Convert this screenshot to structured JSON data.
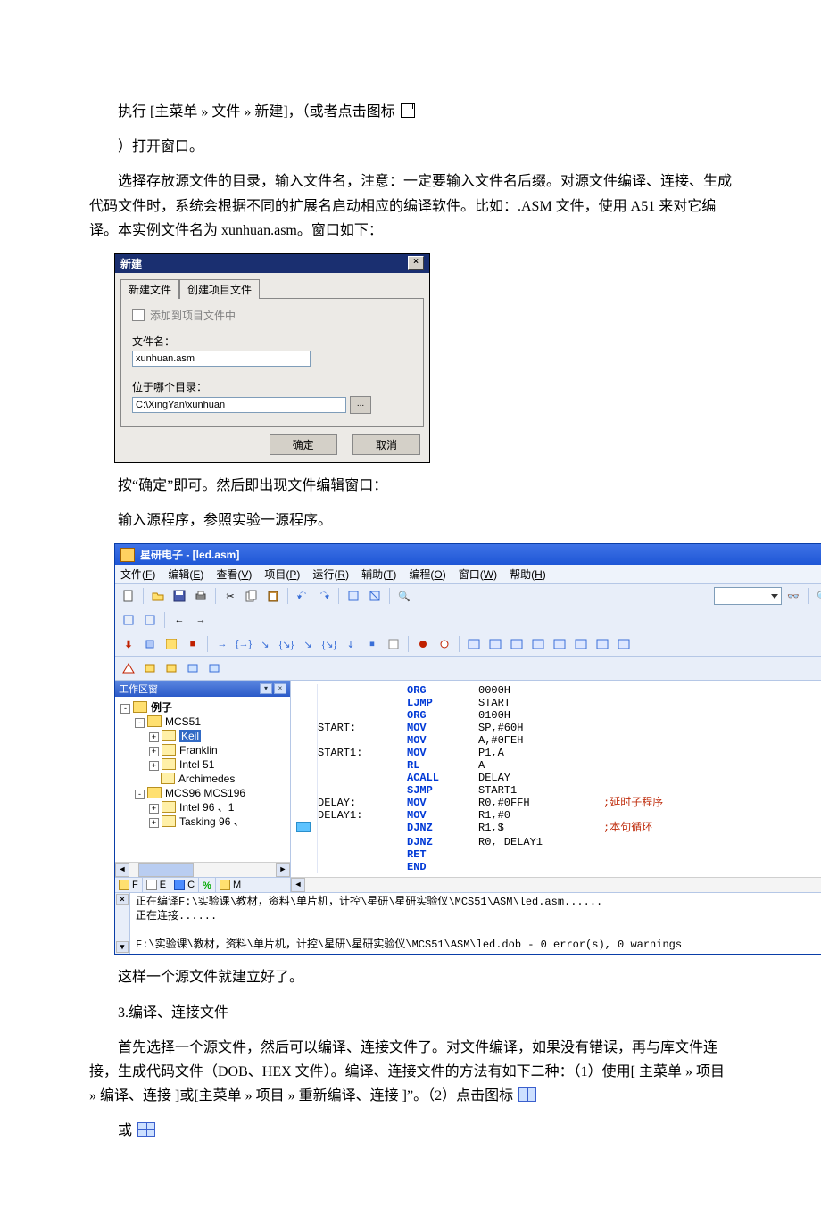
{
  "paragraphs": {
    "p1_a": "执行 [主菜单 » 文件 » 新建]，（或者点击图标",
    "p1_b": "）打开窗口。",
    "p2": "选择存放源文件的目录，输入文件名，注意：一定要输入文件名后缀。对源文件编译、连接、生成代码文件时，系统会根据不同的扩展名启动相应的编译软件。比如：.ASM 文件，使用 A51 来对它编译。本实例文件名为 xunhuan.asm。窗口如下：",
    "p3": "按“确定”即可。然后即出现文件编辑窗口：",
    "p4": "输入源程序，参照实验一源程序。",
    "p5": "这样一个源文件就建立好了。",
    "p6": "3.编译、连接文件",
    "p7_a": "首先选择一个源文件，然后可以编译、连接文件了。对文件编译，如果没有错误，再与库文件连接，生成代码文件（DOB、HEX 文件）。编译、连接文件的方法有如下二种：（1）使用[ 主菜单 » 项目 » 编译、连接 ]或[主菜单 » 项目 » 重新编译、连接 ]”。（2）点击图标",
    "p7_b": "或"
  },
  "dialog": {
    "title": "新建",
    "tab_new": "新建文件",
    "tab_proj": "创建项目文件",
    "chk_label": "添加到项目文件中",
    "filename_label": "文件名：",
    "filename_value": "xunhuan.asm",
    "dir_label": "位于哪个目录：",
    "dir_value": "C:\\XingYan\\xunhuan",
    "browse": "...",
    "ok": "确定",
    "cancel": "取消",
    "close_x": "×"
  },
  "ide": {
    "title": "星研电子 - [led.asm]",
    "menus": [
      {
        "t": "文件",
        "a": "F"
      },
      {
        "t": "编辑",
        "a": "E"
      },
      {
        "t": "查看",
        "a": "V"
      },
      {
        "t": "项目",
        "a": "P"
      },
      {
        "t": "运行",
        "a": "R"
      },
      {
        "t": "辅助",
        "a": "T"
      },
      {
        "t": "编程",
        "a": "O"
      },
      {
        "t": "窗口",
        "a": "W"
      },
      {
        "t": "帮助",
        "a": "H"
      }
    ],
    "workspace_title": "工作区窗",
    "tree_root": "例子",
    "tree": [
      {
        "lvl": 1,
        "open": true,
        "label": "MCS51",
        "pm": "-"
      },
      {
        "lvl": 2,
        "open": false,
        "label": "Keil",
        "pm": "+",
        "sel": true
      },
      {
        "lvl": 2,
        "open": false,
        "label": "Franklin",
        "pm": "+"
      },
      {
        "lvl": 2,
        "open": false,
        "label": "Intel 51",
        "pm": "+"
      },
      {
        "lvl": 2,
        "open": false,
        "label": "Archimedes",
        "pm": ""
      },
      {
        "lvl": 1,
        "open": true,
        "label": "MCS96 MCS196",
        "pm": "-"
      },
      {
        "lvl": 2,
        "open": false,
        "label": "Intel 96 、1",
        "pm": "+"
      },
      {
        "lvl": 2,
        "open": false,
        "label": "Tasking 96 、",
        "pm": "+"
      }
    ],
    "ws_tabs": [
      "F",
      "E",
      "C",
      "%",
      "M"
    ],
    "ws_tab_labels": {
      "F": "F",
      "E": "E",
      "C": "C",
      "pct": "%",
      "M": "M"
    },
    "code": [
      {
        "gut": "",
        "lbl": "",
        "op": "ORG",
        "arg": "0000H",
        "cmt": ""
      },
      {
        "gut": "",
        "lbl": "",
        "op": "LJMP",
        "arg": "START",
        "cmt": ""
      },
      {
        "gut": "",
        "lbl": "",
        "op": "",
        "arg": "",
        "cmt": ""
      },
      {
        "gut": "",
        "lbl": "",
        "op": "ORG",
        "arg": "0100H",
        "cmt": ""
      },
      {
        "gut": "",
        "lbl": "START:",
        "op": "MOV",
        "arg": "SP,#60H",
        "cmt": ""
      },
      {
        "gut": "",
        "lbl": "",
        "op": "MOV",
        "arg": "A,#0FEH",
        "cmt": ""
      },
      {
        "gut": "",
        "lbl": "START1:",
        "op": "MOV",
        "arg": "P1,A",
        "cmt": ""
      },
      {
        "gut": "",
        "lbl": "",
        "op": "RL",
        "arg": "A",
        "cmt": ""
      },
      {
        "gut": "",
        "lbl": "",
        "op": "ACALL",
        "arg": "DELAY",
        "cmt": ""
      },
      {
        "gut": "",
        "lbl": "",
        "op": "SJMP",
        "arg": "START1",
        "cmt": ""
      },
      {
        "gut": "",
        "lbl": "",
        "op": "",
        "arg": "",
        "cmt": ""
      },
      {
        "gut": "",
        "lbl": "DELAY:",
        "op": "MOV",
        "arg": "R0,#0FFH",
        "cmt": ";延时子程序"
      },
      {
        "gut": "",
        "lbl": "DELAY1:",
        "op": "MOV",
        "arg": "R1,#0",
        "cmt": ""
      },
      {
        "gut": "bp",
        "lbl": "",
        "op": "DJNZ",
        "arg": "R1,$",
        "cmt": ";本句循环"
      },
      {
        "gut": "",
        "lbl": "",
        "op": "DJNZ",
        "arg": "R0, DELAY1",
        "cmt": ""
      },
      {
        "gut": "",
        "lbl": "",
        "op": "RET",
        "arg": "",
        "cmt": ""
      },
      {
        "gut": "",
        "lbl": "",
        "op": "END",
        "arg": "",
        "cmt": ""
      }
    ],
    "output": [
      "正在编译F:\\实验课\\教材，资料\\单片机，计控\\星研\\星研实验仪\\MCS51\\ASM\\led.asm......",
      "正在连接......",
      "",
      "F:\\实验课\\教材，资料\\单片机，计控\\星研\\星研实验仪\\MCS51\\ASM\\led.dob - 0 error(s), 0 warnings"
    ]
  }
}
